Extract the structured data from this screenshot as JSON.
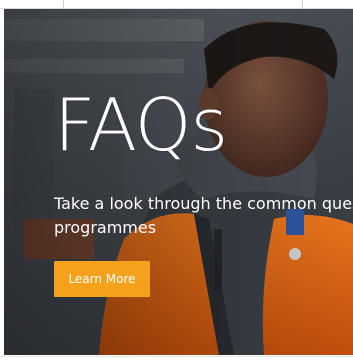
{
  "hero": {
    "title": "FAQs",
    "description_line1": "Take a look through the common questions about our",
    "description_line2": "programmes",
    "cta_label": "Learn More"
  },
  "colors": {
    "accent": "#f5a11b",
    "overlay": "#3b3f46",
    "vest": "#f06a12",
    "text": "#ffffff"
  }
}
